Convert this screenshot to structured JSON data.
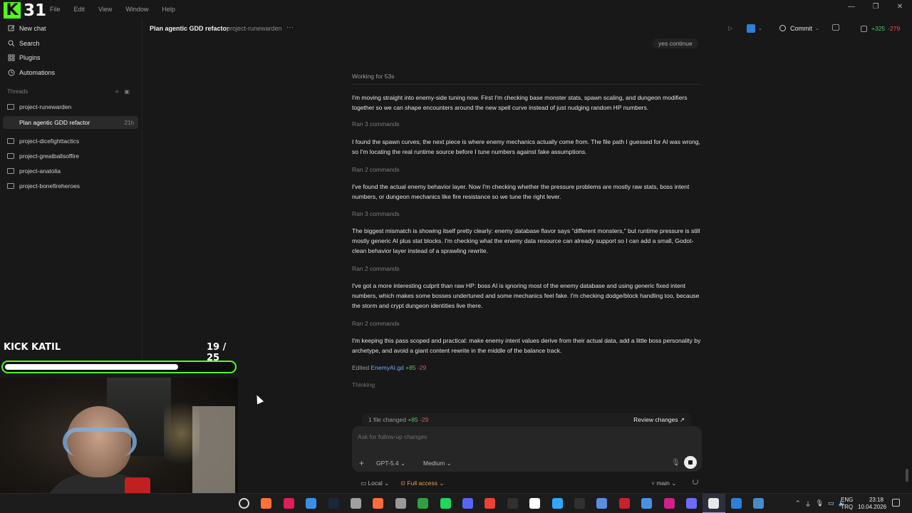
{
  "app": {
    "logo_letter": "K",
    "logo_number": "31",
    "menu": [
      "File",
      "Edit",
      "View",
      "Window",
      "Help"
    ],
    "window_controls": [
      "—",
      "❐",
      "✕"
    ]
  },
  "sidebar": {
    "nav": [
      {
        "label": "New chat",
        "icon": "edit-icon"
      },
      {
        "label": "Search",
        "icon": "search-icon"
      },
      {
        "label": "Plugins",
        "icon": "plugin-icon"
      },
      {
        "label": "Automations",
        "icon": "clock-icon"
      }
    ],
    "threads_heading": "Threads",
    "threads": [
      {
        "label": "project-runewarden",
        "age": ""
      },
      {
        "label": "Plan agentic GDD refactor",
        "age": "21h",
        "active": true
      },
      {
        "label": "project-dicefighttactics",
        "age": ""
      },
      {
        "label": "project-greatballsoffire",
        "age": ""
      },
      {
        "label": "project-anatolia",
        "age": ""
      },
      {
        "label": "project-bonefireheroes",
        "age": ""
      }
    ]
  },
  "header": {
    "title": "Plan agentic GDD refactor",
    "project": "project-runewarden",
    "more": "···",
    "commit_label": "Commit",
    "diff_add": "+325",
    "diff_del": "-279"
  },
  "chat": {
    "user_message": "yes continue",
    "working": "Working for 53s",
    "paragraphs": [
      "I'm moving straight into enemy-side tuning now. First I'm checking base monster stats, spawn scaling, and dungeon modifiers together so we can shape encounters around the new spell curve instead of just nudging random HP numbers.",
      "I found the spawn curves; the next piece is where enemy mechanics actually come from. The file path I guessed for AI was wrong, so I'm locating the real runtime source before I tune numbers against fake assumptions.",
      "I've found the actual enemy behavior layer. Now I'm checking whether the pressure problems are mostly raw stats, boss intent numbers, or dungeon mechanics like fire resistance so we tune the right lever.",
      "The biggest mismatch is showing itself pretty clearly: enemy database flavor says \"different monsters,\" but runtime pressure is still mostly generic AI plus stat blocks. I'm checking what the enemy data resource can already support so I can add a small, Godot-clean behavior layer instead of a sprawling rewrite.",
      "I've got a more interesting culprit than raw HP: boss AI is ignoring most of the enemy database and using generic fixed intent numbers, which makes some bosses undertuned and some mechanics feel fake. I'm checking dodge/block handling too, because the storm and crypt dungeon identities live there.",
      "I'm keeping this pass scoped and practical: make enemy intent values derive from their actual data, add a little boss personality by archetype, and avoid a giant content rewrite in the middle of the balance track."
    ],
    "ran": [
      "Ran 3 commands",
      "Ran 2 commands",
      "Ran 3 commands",
      "Ran 2 commands",
      "Ran 2 commands"
    ],
    "edited_prefix": "Edited",
    "edited_file": "EnemyAI.gd",
    "edited_add": "+85",
    "edited_del": "-29",
    "thinking": "Thinking"
  },
  "composer": {
    "changes": "1 file changed",
    "changes_add": "+85",
    "changes_del": "-29",
    "review": "Review changes ↗",
    "placeholder": "Ask for follow-up changes",
    "model": "GPT-5.4 ⌄",
    "effort": "Medium ⌄",
    "local": "▭ Local ⌄",
    "access": "⊙ Full access ⌄",
    "branch": "⑂ main ⌄"
  },
  "overlay": {
    "name": "KICK KATIL",
    "count": "19 / 25",
    "progress": 0.76
  },
  "taskbar": {
    "lang_line1": "ENG",
    "lang_line2": "TRQ",
    "time": "23:18",
    "date": "10.04.2026",
    "accent_colors": [
      "#d8d8d8",
      "#ff7139",
      "#e01e5a",
      "#3b8ee8",
      "#1b2838",
      "#a0a0a0",
      "#ff6b3d",
      "#9a9a9a",
      "#2ea043",
      "#1ed760",
      "#5865f2",
      "#ea4335",
      "#303030",
      "#ffffff",
      "#31a8ff",
      "#303030",
      "#5a8de0",
      "#c8202f",
      "#4a90e2",
      "#d0208a",
      "#6c6cff",
      "#e8e8e8",
      "#2f7fd6",
      "#4a8ac8"
    ]
  },
  "colors": {
    "kick_green": "#53fc18",
    "add": "#4fc372",
    "del": "#e0555a",
    "link": "#6aa8ff",
    "access": "#e6a04a"
  }
}
